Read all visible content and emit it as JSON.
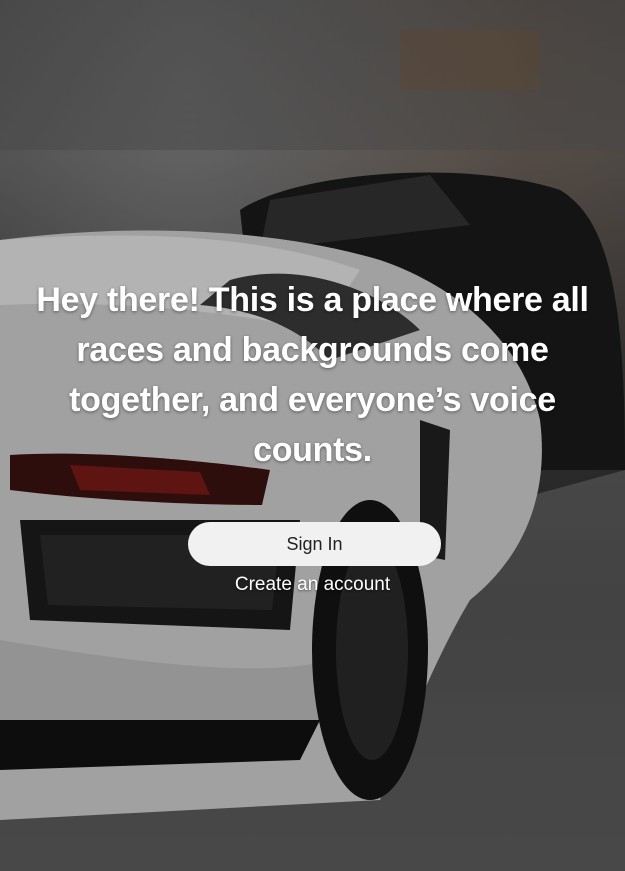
{
  "hero": {
    "tagline": "Hey there! This is a place where all races and backgrounds come together, and everyone’s voice counts."
  },
  "actions": {
    "sign_in_label": "Sign In",
    "create_account_label": "Create an account"
  },
  "colors": {
    "button_bg": "#f1f1f1",
    "button_text": "#222222",
    "text": "#ffffff"
  }
}
